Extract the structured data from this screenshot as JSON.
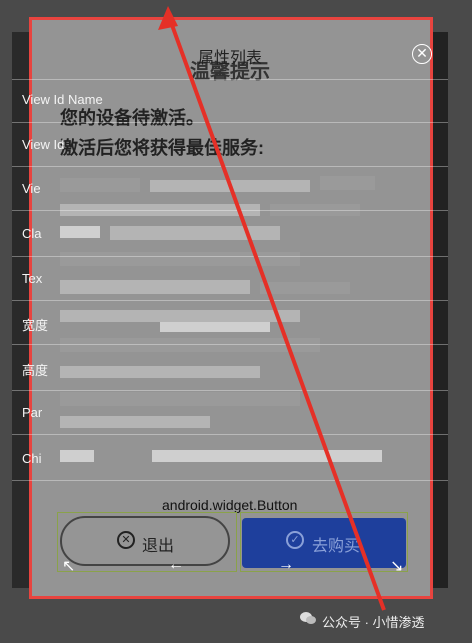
{
  "background_list": {
    "rows": [
      "View Id Name",
      "View Id",
      "View",
      "Class",
      "Text",
      "宽度",
      "高度",
      "Parent",
      "Children"
    ]
  },
  "dialog": {
    "title": "温馨提示",
    "line1": "您的设备待激活。",
    "line2": "激活后您将获得最佳服务:",
    "exit_label": "退出",
    "buy_label": "去购买"
  },
  "property_panel": {
    "title": "属性列表",
    "labels": [
      "View Id Name",
      "View Id",
      "Vie",
      "Cla",
      "Tex",
      "宽度",
      "高度",
      "Par",
      "Chi"
    ],
    "widget_class": "android.widget.Button"
  },
  "watermark": "公众号 · 小惜渗透",
  "colors": {
    "highlight": "#e8443f",
    "buy_button": "#1e3f9c"
  }
}
